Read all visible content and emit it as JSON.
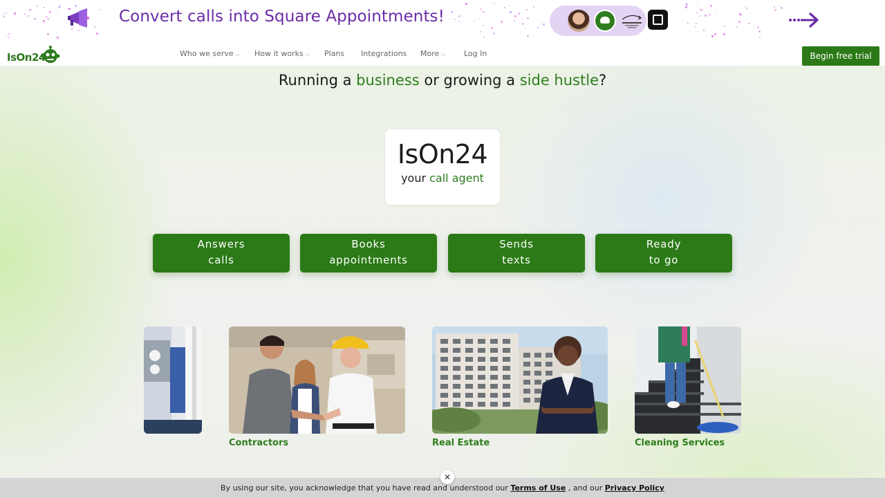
{
  "banner": {
    "text": "Convert calls into Square Appointments!",
    "flow_label": "Square Appointments"
  },
  "nav": {
    "logo_text": "IsOn24",
    "items": [
      {
        "label": "Who we serve",
        "dropdown": true
      },
      {
        "label": "How it works",
        "dropdown": true
      },
      {
        "label": "Plans",
        "dropdown": false
      },
      {
        "label": "Integrations",
        "dropdown": false
      },
      {
        "label": "More",
        "dropdown": true
      },
      {
        "label": "Log In",
        "dropdown": false
      }
    ],
    "chevron": "⌵",
    "cta_label": "Begin free trial"
  },
  "hero": {
    "headline_part1": "Running a ",
    "headline_hl1": "business",
    "headline_part2": " or growing a ",
    "headline_hl2": "side hustle",
    "headline_part3": "?",
    "card_title": "IsOn24",
    "card_sub_prefix": "your ",
    "card_sub_hl": "call agent",
    "features": [
      {
        "line1": "Answers",
        "line2": "calls"
      },
      {
        "line1": "Books",
        "line2": "appointments"
      },
      {
        "line1": "Sends",
        "line2": "texts"
      },
      {
        "line1": "Ready",
        "line2": "to go"
      }
    ]
  },
  "categories": [
    {
      "label": "Contractors"
    },
    {
      "label": "Real Estate"
    },
    {
      "label": "Cleaning Services"
    }
  ],
  "cookie": {
    "text_before": "By using our site, you acknowledge that you have read and understood our ",
    "terms_label": "Terms of Use",
    "text_middle": " , and our ",
    "privacy_label": "Privacy Policy",
    "close_glyph": "✕"
  },
  "colors": {
    "brand_green": "#2b7a17",
    "banner_purple": "#6a2ca6"
  },
  "icons": [
    "megaphone-icon",
    "robot-logo-icon",
    "square-logo-icon",
    "arrow-right-icon",
    "close-icon",
    "chevron-down-icon"
  ]
}
